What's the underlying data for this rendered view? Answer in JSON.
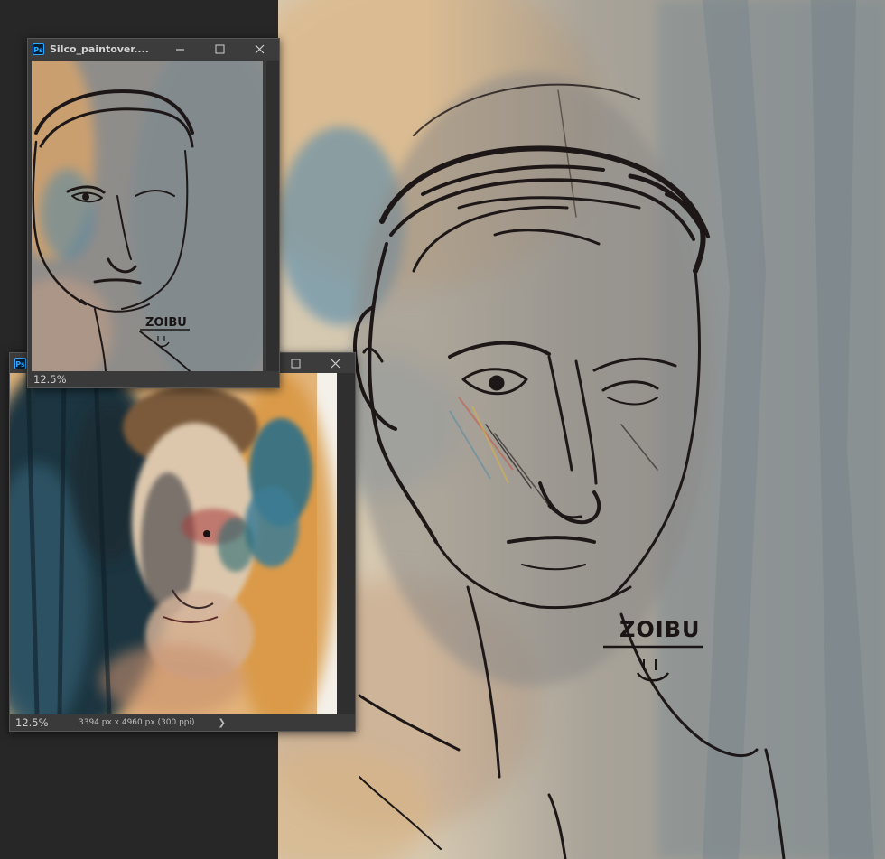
{
  "window1": {
    "title": "Silco_paintover....",
    "zoom": "12.5%"
  },
  "window2": {
    "zoom": "12.5%",
    "doc_info": "3394 px x 4960 px (300 ppi)",
    "info_arrow": "❯"
  },
  "signature": {
    "text": "ZOIBU"
  },
  "icons": {
    "app": "photoshop-icon",
    "minimize": "minimize-icon",
    "maximize": "maximize-icon",
    "close": "close-icon"
  },
  "colors": {
    "workspace": "#272727",
    "ps_icon_bg": "#001e36",
    "ps_icon_fg": "#31a8ff",
    "paper": "#d8cbb4",
    "wash_blue": "#4f7d96",
    "wash_orange": "#d99a4e",
    "ink": "#1c1616"
  }
}
